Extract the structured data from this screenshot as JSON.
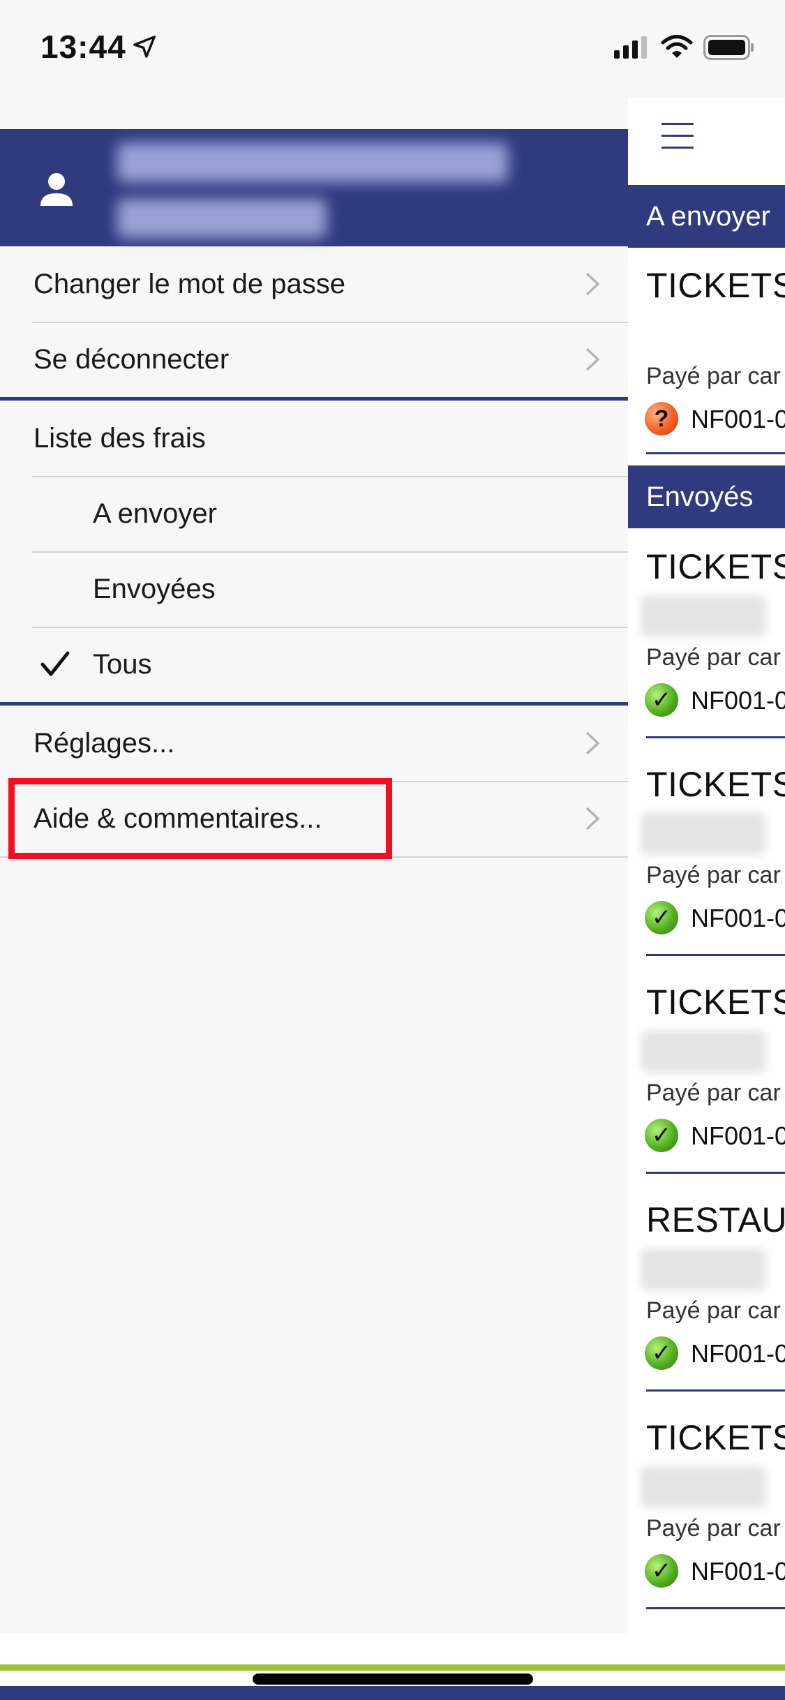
{
  "status_bar": {
    "time": "13:44"
  },
  "drawer": {
    "account_items": [
      {
        "label": "Changer le mot de passe"
      },
      {
        "label": "Se déconnecter"
      }
    ],
    "list_section": {
      "title": "Liste des frais",
      "filters": [
        {
          "label": "A envoyer",
          "selected": false
        },
        {
          "label": "Envoyées",
          "selected": false
        },
        {
          "label": "Tous",
          "selected": true
        }
      ]
    },
    "settings_items": [
      {
        "label": "Réglages..."
      },
      {
        "label": "Aide & commentaires..."
      }
    ]
  },
  "main": {
    "sections": [
      {
        "header": "A envoyer"
      },
      {
        "header": "Envoyés"
      }
    ],
    "cards": [
      {
        "title": "TICKETS",
        "pay": "Payé par car",
        "ref": "NF001-0",
        "status": "pending"
      },
      {
        "title": "TICKETS",
        "pay": "Payé par car",
        "ref": "NF001-0",
        "status": "sent"
      },
      {
        "title": "TICKETS",
        "pay": "Payé par car",
        "ref": "NF001-0",
        "status": "sent"
      },
      {
        "title": "TICKETS",
        "pay": "Payé par car",
        "ref": "NF001-0",
        "status": "sent"
      },
      {
        "title": "RESTAU",
        "pay": "Payé par car",
        "ref": "NF001-0",
        "status": "sent"
      },
      {
        "title": "TICKETS",
        "pay": "Payé par car",
        "ref": "NF001-0",
        "status": "sent"
      }
    ]
  },
  "colors": {
    "brand_navy": "#2f3a7f",
    "accent_lime": "#a2c33d",
    "highlight_red": "#f0101f",
    "status_sent": "#4cab1b",
    "status_pending": "#f25b1a"
  }
}
